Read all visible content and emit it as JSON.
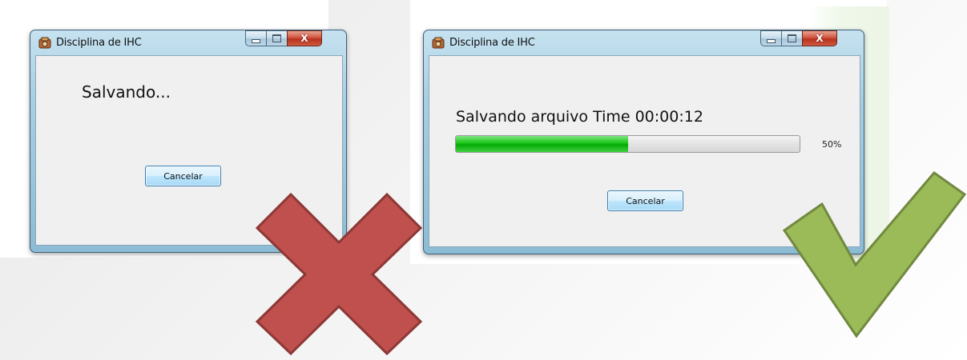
{
  "window_bad": {
    "title": "Disciplina de IHC",
    "message": "Salvando...",
    "cancel_label": "Cancelar"
  },
  "window_good": {
    "title": "Disciplina de IHC",
    "message": "Salvando arquivo Time 00:00:12",
    "progress_fraction": 0.5,
    "percent_label": "50%",
    "cancel_label": "Cancelar"
  },
  "caption_buttons": {
    "close_glyph": "X"
  },
  "icons": {
    "app": "app-icon",
    "wrong": "red-x-cross-icon",
    "right": "green-checkmark-icon"
  },
  "colors": {
    "cross_fill": "#c0504d",
    "cross_stroke": "#8c3836",
    "check_fill": "#9bbb59",
    "check_stroke": "#71893f",
    "progress_green": "#06a806"
  }
}
